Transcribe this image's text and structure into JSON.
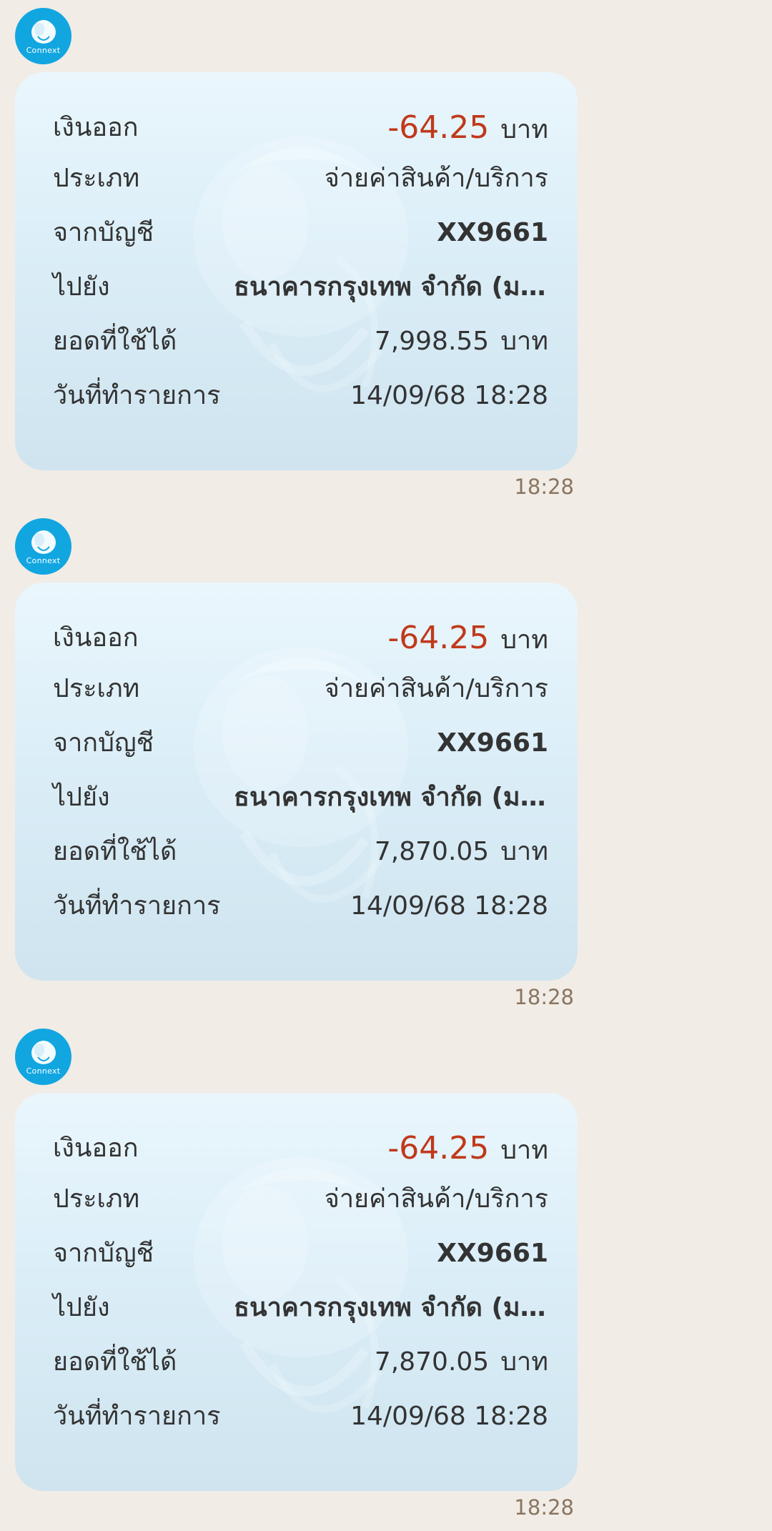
{
  "sender": {
    "avatar_label": "Connext"
  },
  "messages": [
    {
      "labels": {
        "debit": "เงินออก",
        "type": "ประเภท",
        "from_account": "จากบัญชี",
        "to": "ไปยัง",
        "available_balance": "ยอดที่ใช้ได้",
        "transaction_date": "วันที่ทำรายการ"
      },
      "amount": "-64.25",
      "amount_unit": "บาท",
      "type": "จ่ายค่าสินค้า/บริการ",
      "from_account": "XX9661",
      "to": "ธนาคารกรุงเทพ จำกัด (มห...",
      "available_balance": "7,998.55",
      "balance_unit": "บาท",
      "transaction_date": "14/09/68 18:28",
      "time": "18:28"
    },
    {
      "labels": {
        "debit": "เงินออก",
        "type": "ประเภท",
        "from_account": "จากบัญชี",
        "to": "ไปยัง",
        "available_balance": "ยอดที่ใช้ได้",
        "transaction_date": "วันที่ทำรายการ"
      },
      "amount": "-64.25",
      "amount_unit": "บาท",
      "type": "จ่ายค่าสินค้า/บริการ",
      "from_account": "XX9661",
      "to": "ธนาคารกรุงเทพ จำกัด (มห...",
      "available_balance": "7,870.05",
      "balance_unit": "บาท",
      "transaction_date": "14/09/68 18:28",
      "time": "18:28"
    },
    {
      "labels": {
        "debit": "เงินออก",
        "type": "ประเภท",
        "from_account": "จากบัญชี",
        "to": "ไปยัง",
        "available_balance": "ยอดที่ใช้ได้",
        "transaction_date": "วันที่ทำรายการ"
      },
      "amount": "-64.25",
      "amount_unit": "บาท",
      "type": "จ่ายค่าสินค้า/บริการ",
      "from_account": "XX9661",
      "to": "ธนาคารกรุงเทพ จำกัด (มห...",
      "available_balance": "7,870.05",
      "balance_unit": "บาท",
      "transaction_date": "14/09/68 18:28",
      "time": "18:28"
    }
  ],
  "colors": {
    "background": "#f1ece6",
    "avatar": "#11a6e0",
    "negative_amount": "#c0391b",
    "timestamp": "#8a7560"
  },
  "icons": {
    "avatar": "kbank-bird-logo-icon",
    "watermark": "kbank-bird-watermark-icon"
  }
}
